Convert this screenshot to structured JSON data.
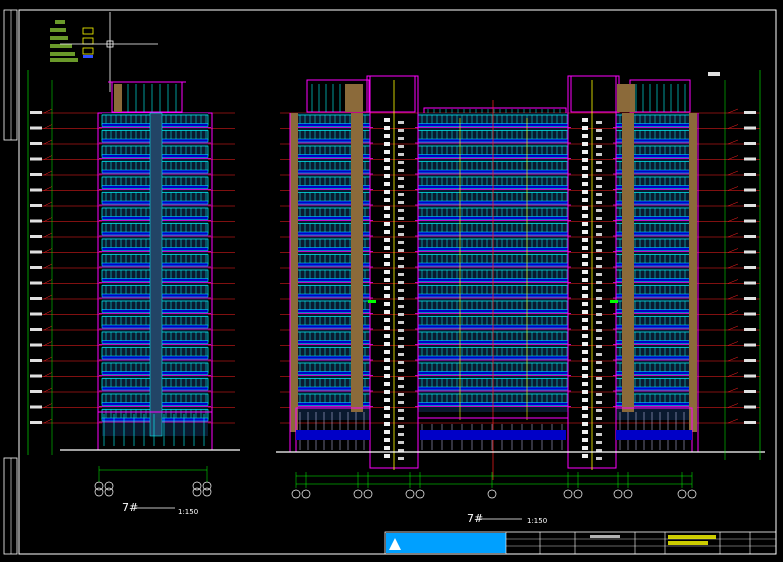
{
  "drawing": {
    "left_elevation": {
      "number": "7#",
      "scale": "1:150"
    },
    "front_elevation": {
      "number": "7#",
      "scale": "1:150"
    }
  },
  "colors": {
    "background": "#000000",
    "frame": "#ffffff",
    "wall": "#ff00ff",
    "window": "#00ffff",
    "balcony": "#0000c8",
    "level_line": "#ff2020",
    "dimension": "#00ff00",
    "text": "#ffff00",
    "infill": "#8b6a3a",
    "title_bar": "#00a0ff"
  },
  "icons": [
    "cad-crosshair-cursor",
    "axis-bubble",
    "north-triangle-logo"
  ]
}
